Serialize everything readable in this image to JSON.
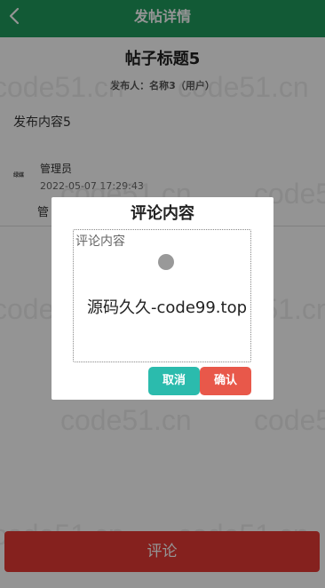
{
  "header": {
    "back_icon": "chevron-left-icon",
    "title": "发帖详情"
  },
  "post": {
    "title": "帖子标题5",
    "author": "发布人：名称3（用户）",
    "content": "发布内容5"
  },
  "comment": {
    "avatar_text": "绿媒",
    "user": "管理员",
    "time": "2022-05-07 17:29:43",
    "text": "管"
  },
  "bottom_button": {
    "label": "评论"
  },
  "watermarks": [
    "code51.cn",
    "code51.cn",
    "code51.cn",
    "code51.cn",
    "code51.cn",
    "code51.cn",
    "code51.cn",
    "code51.cn",
    "code51.cn",
    "code51.cn",
    "code51.cn",
    "code51.cn"
  ],
  "modal": {
    "title": "评论内容",
    "placeholder": "评论内容",
    "watermark": "源码久久-code99.top",
    "cancel_label": "取消",
    "confirm_label": "确认"
  },
  "colors": {
    "header": "#1f9c5e",
    "primary": "#e53935",
    "cancel": "#2bbbad",
    "confirm": "#e8584a"
  }
}
